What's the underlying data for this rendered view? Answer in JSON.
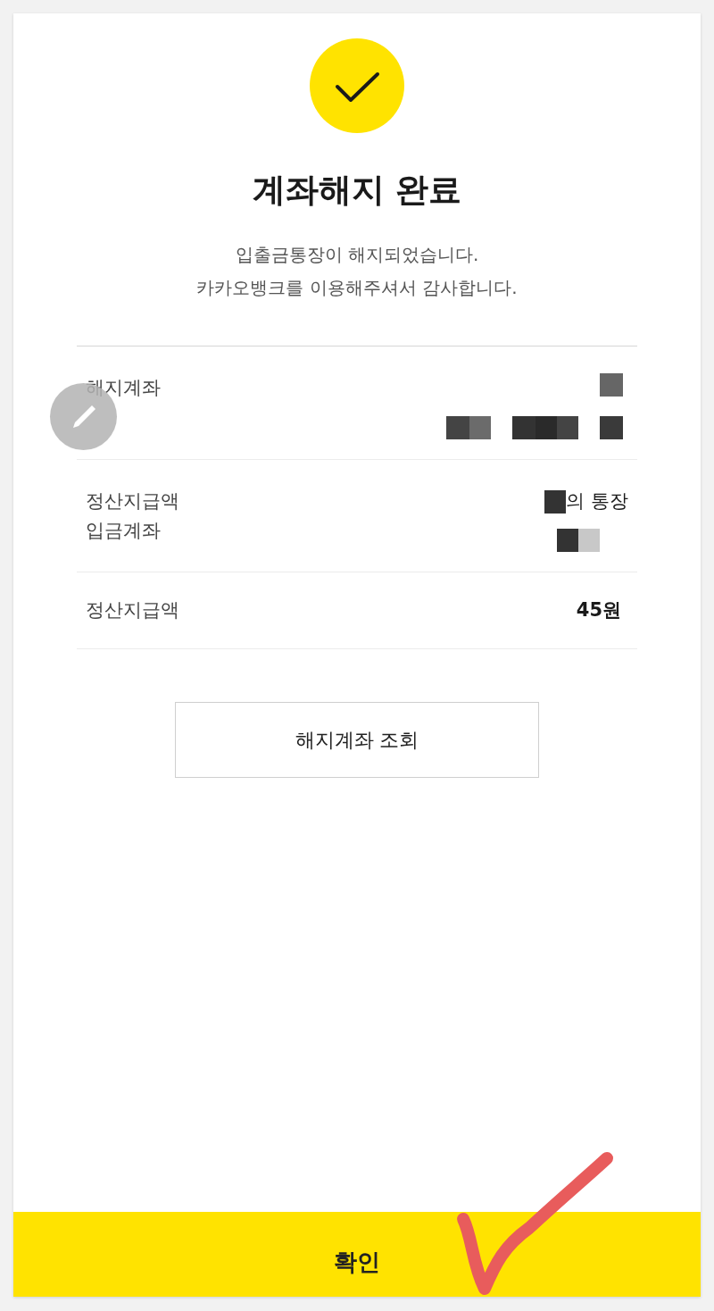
{
  "header": {
    "title": "계좌해지 완료",
    "message": [
      "입출금통장이 해지되었습니다.",
      "카카오뱅크를 이용해주셔서 감사합니다."
    ]
  },
  "details": [
    {
      "kind": "account",
      "label": [
        "해지계좌"
      ]
    },
    {
      "kind": "deposit",
      "label": [
        "정산지급액",
        "입금계좌"
      ],
      "value": "의 통장"
    },
    {
      "kind": "amount",
      "label": [
        "정산지급액"
      ],
      "value": "45원"
    }
  ],
  "lookup_button": "해지계좌 조회",
  "confirm_button": "확인"
}
